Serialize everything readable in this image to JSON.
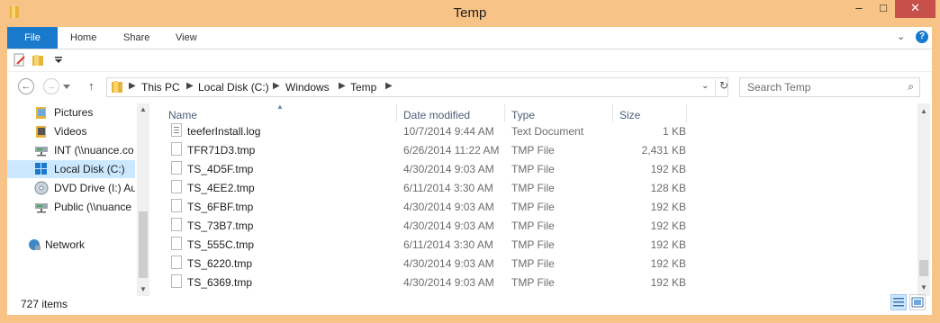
{
  "window": {
    "title": "Temp"
  },
  "titlebar": {
    "min": "–",
    "max": "□",
    "close": "✕"
  },
  "ribbon": {
    "tabs": [
      {
        "label": "File"
      },
      {
        "label": "Home"
      },
      {
        "label": "Share"
      },
      {
        "label": "View"
      }
    ],
    "help": "?",
    "expand": "⌄"
  },
  "address": {
    "back": "←",
    "forward": "→",
    "up": "↑",
    "crumbs": [
      "This PC",
      "Local Disk (C:)",
      "Windows",
      "Temp"
    ],
    "search_placeholder": "Search Temp"
  },
  "nav": {
    "items": [
      {
        "label": "Pictures",
        "icon": "pictures-folder-icon"
      },
      {
        "label": "Videos",
        "icon": "videos-folder-icon"
      },
      {
        "label": "INT (\\\\nuance.co",
        "icon": "network-drive-icon"
      },
      {
        "label": "Local Disk (C:)",
        "icon": "windows-drive-icon",
        "selected": true
      },
      {
        "label": "DVD Drive (I:) Au",
        "icon": "dvd-drive-icon"
      },
      {
        "label": "Public (\\\\nuance",
        "icon": "network-drive-icon"
      },
      {
        "label": "Network",
        "icon": "network-icon"
      }
    ]
  },
  "files": {
    "columns": {
      "name": "Name",
      "date": "Date modified",
      "type": "Type",
      "size": "Size"
    },
    "rows": [
      {
        "name": "teeferInstall.log",
        "date": "10/7/2014 9:44 AM",
        "type": "Text Document",
        "size": "1 KB"
      },
      {
        "name": "TFR71D3.tmp",
        "date": "6/26/2014 11:22 AM",
        "type": "TMP File",
        "size": "2,431 KB"
      },
      {
        "name": "TS_4D5F.tmp",
        "date": "4/30/2014 9:03 AM",
        "type": "TMP File",
        "size": "192 KB"
      },
      {
        "name": "TS_4EE2.tmp",
        "date": "6/11/2014 3:30 AM",
        "type": "TMP File",
        "size": "128 KB"
      },
      {
        "name": "TS_6FBF.tmp",
        "date": "4/30/2014 9:03 AM",
        "type": "TMP File",
        "size": "192 KB"
      },
      {
        "name": "TS_73B7.tmp",
        "date": "4/30/2014 9:03 AM",
        "type": "TMP File",
        "size": "192 KB"
      },
      {
        "name": "TS_555C.tmp",
        "date": "6/11/2014 3:30 AM",
        "type": "TMP File",
        "size": "192 KB"
      },
      {
        "name": "TS_6220.tmp",
        "date": "4/30/2014 9:03 AM",
        "type": "TMP File",
        "size": "192 KB"
      },
      {
        "name": "TS_6369.tmp",
        "date": "4/30/2014 9:03 AM",
        "type": "TMP File",
        "size": "192 KB"
      }
    ]
  },
  "status": {
    "item_count": "727 items"
  },
  "colors": {
    "frame": "#f7c386",
    "accent": "#1979ca",
    "close": "#c7504b",
    "selection": "#cce8ff"
  }
}
